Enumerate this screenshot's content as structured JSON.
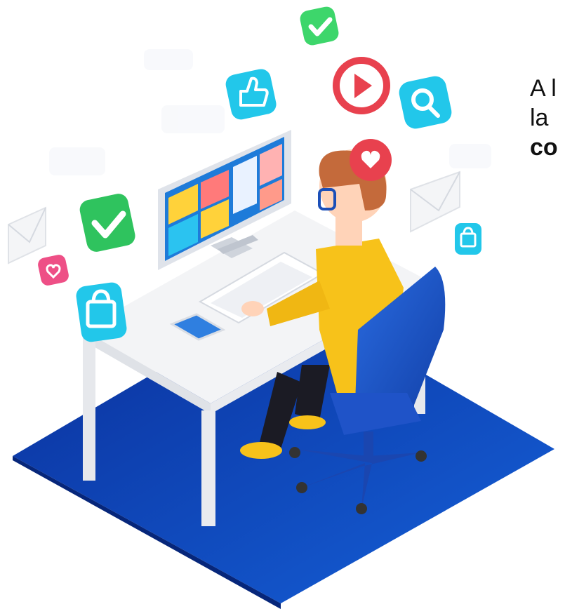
{
  "caption": {
    "line1": "A l",
    "line2": "la",
    "line3": "co"
  },
  "colors": {
    "floor": "#0b36a8",
    "floor_edge": "#06267a",
    "desk": "#f2f3f5",
    "shirt": "#f7c21a",
    "hair": "#c46a3b",
    "chair": "#1f53c8",
    "green": "#2fc35e",
    "cyan": "#22c7ea",
    "red": "#e8414e",
    "pink": "#ee4f86"
  },
  "icons": [
    "check-icon",
    "thumbs-up-icon",
    "play-icon",
    "search-icon",
    "heart-icon",
    "shopping-bag-icon",
    "envelope-icon"
  ]
}
